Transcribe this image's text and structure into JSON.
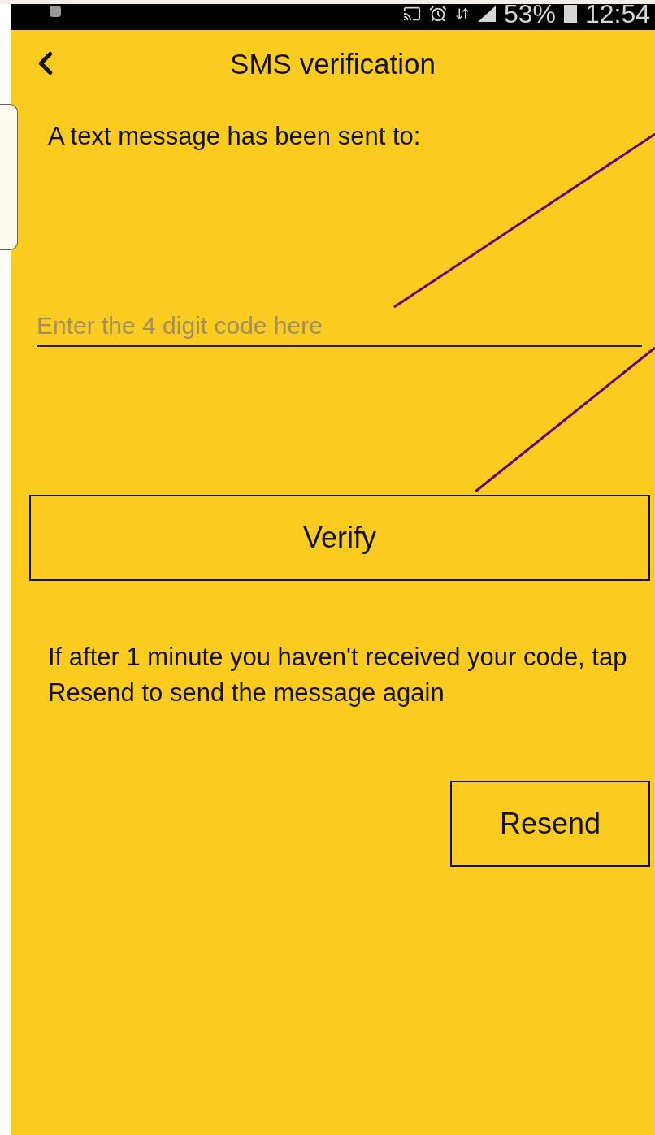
{
  "status_bar": {
    "battery": "53%",
    "time": "12:54"
  },
  "header": {
    "title": "SMS verification"
  },
  "message": "A text message has been sent to:",
  "code_field": {
    "placeholder": "Enter the 4 digit code here"
  },
  "verify_button": "Verify",
  "hint": "If after 1 minute you haven't received your code, tap Resend to send the message again",
  "resend_button": "Resend"
}
